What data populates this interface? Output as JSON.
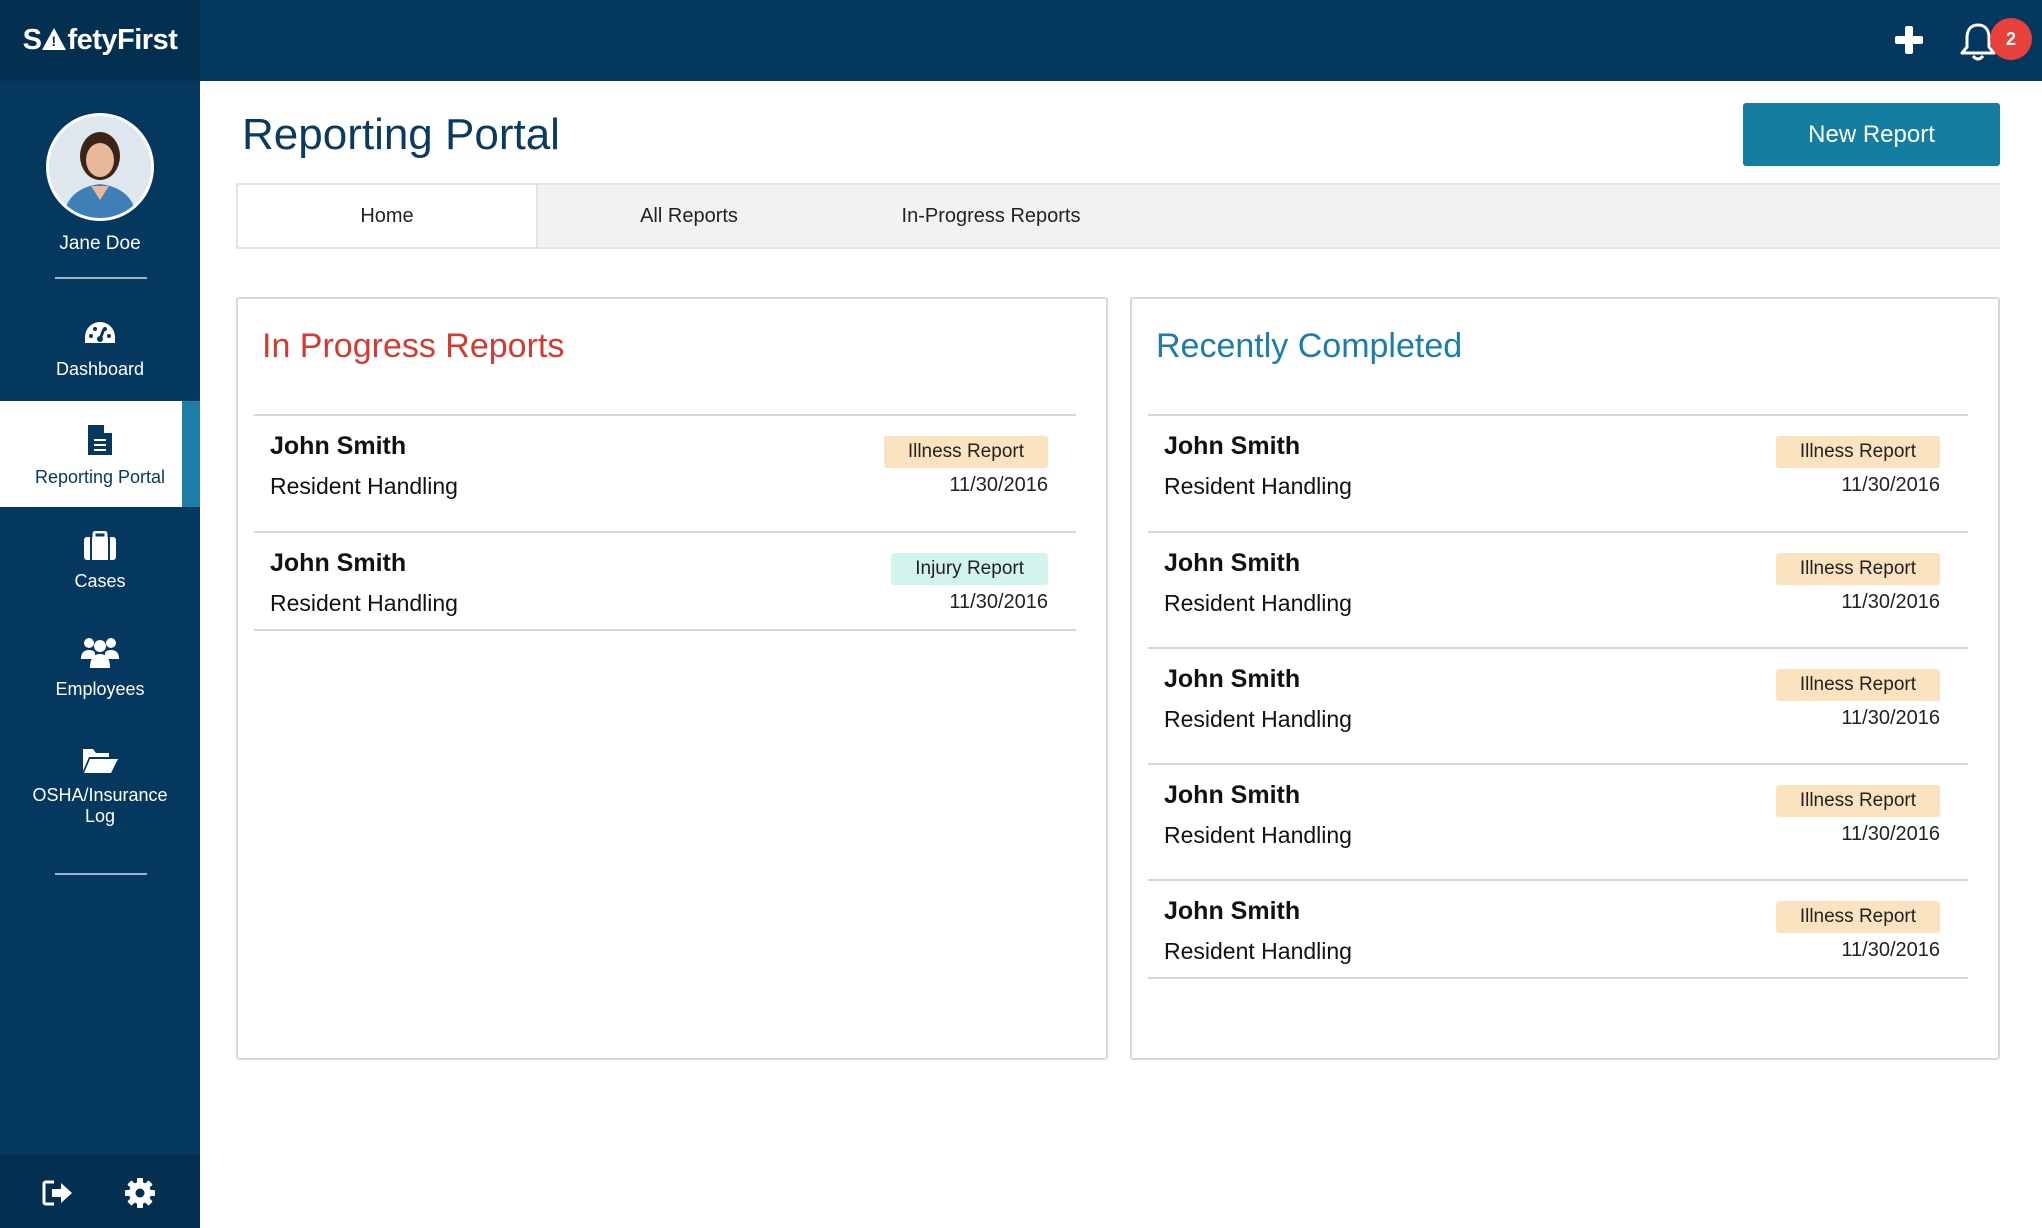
{
  "app": {
    "logo_pre": "S",
    "logo_post": "fetyFirst",
    "notification_count": "2"
  },
  "colors": {
    "primary_dark": "#04385e",
    "accent": "#137ea0",
    "in_progress_title": "#d43a31",
    "completed_title": "#1c7ea6",
    "illness_tag": "#fbe3c0",
    "injury_tag": "#d3f3ee",
    "badge": "#e8403a"
  },
  "icons": {
    "add": "plus-icon",
    "notifications": "bell-icon",
    "dashboard": "speedometer-icon",
    "reporting": "document-icon",
    "cases": "briefcase-icon",
    "employees": "users-icon",
    "osha": "folder-open-icon",
    "logout": "sign-out-icon",
    "settings": "gear-icon"
  },
  "user": {
    "name": "Jane Doe"
  },
  "sidebar": {
    "items": [
      {
        "label": "Dashboard"
      },
      {
        "label": "Reporting Portal"
      },
      {
        "label": "Cases"
      },
      {
        "label": "Employees"
      },
      {
        "label": "OSHA/Insurance",
        "label2": "Log"
      }
    ]
  },
  "page": {
    "title": "Reporting Portal",
    "new_report_label": "New Report"
  },
  "tabs": [
    {
      "label": "Home"
    },
    {
      "label": "All Reports"
    },
    {
      "label": "In-Progress Reports"
    }
  ],
  "in_progress": {
    "title": "In Progress Reports",
    "rows": [
      {
        "name": "John Smith",
        "dept": "Resident Handling",
        "type": "Illness Report",
        "date": "11/30/2016"
      },
      {
        "name": "John Smith",
        "dept": "Resident Handling",
        "type": "Injury Report",
        "date": "11/30/2016"
      }
    ]
  },
  "completed": {
    "title": "Recently Completed",
    "rows": [
      {
        "name": "John Smith",
        "dept": "Resident Handling",
        "type": "Illness Report",
        "date": "11/30/2016"
      },
      {
        "name": "John Smith",
        "dept": "Resident Handling",
        "type": "Illness Report",
        "date": "11/30/2016"
      },
      {
        "name": "John Smith",
        "dept": "Resident Handling",
        "type": "Illness Report",
        "date": "11/30/2016"
      },
      {
        "name": "John Smith",
        "dept": "Resident Handling",
        "type": "Illness Report",
        "date": "11/30/2016"
      },
      {
        "name": "John Smith",
        "dept": "Resident Handling",
        "type": "Illness Report",
        "date": "11/30/2016"
      }
    ]
  }
}
